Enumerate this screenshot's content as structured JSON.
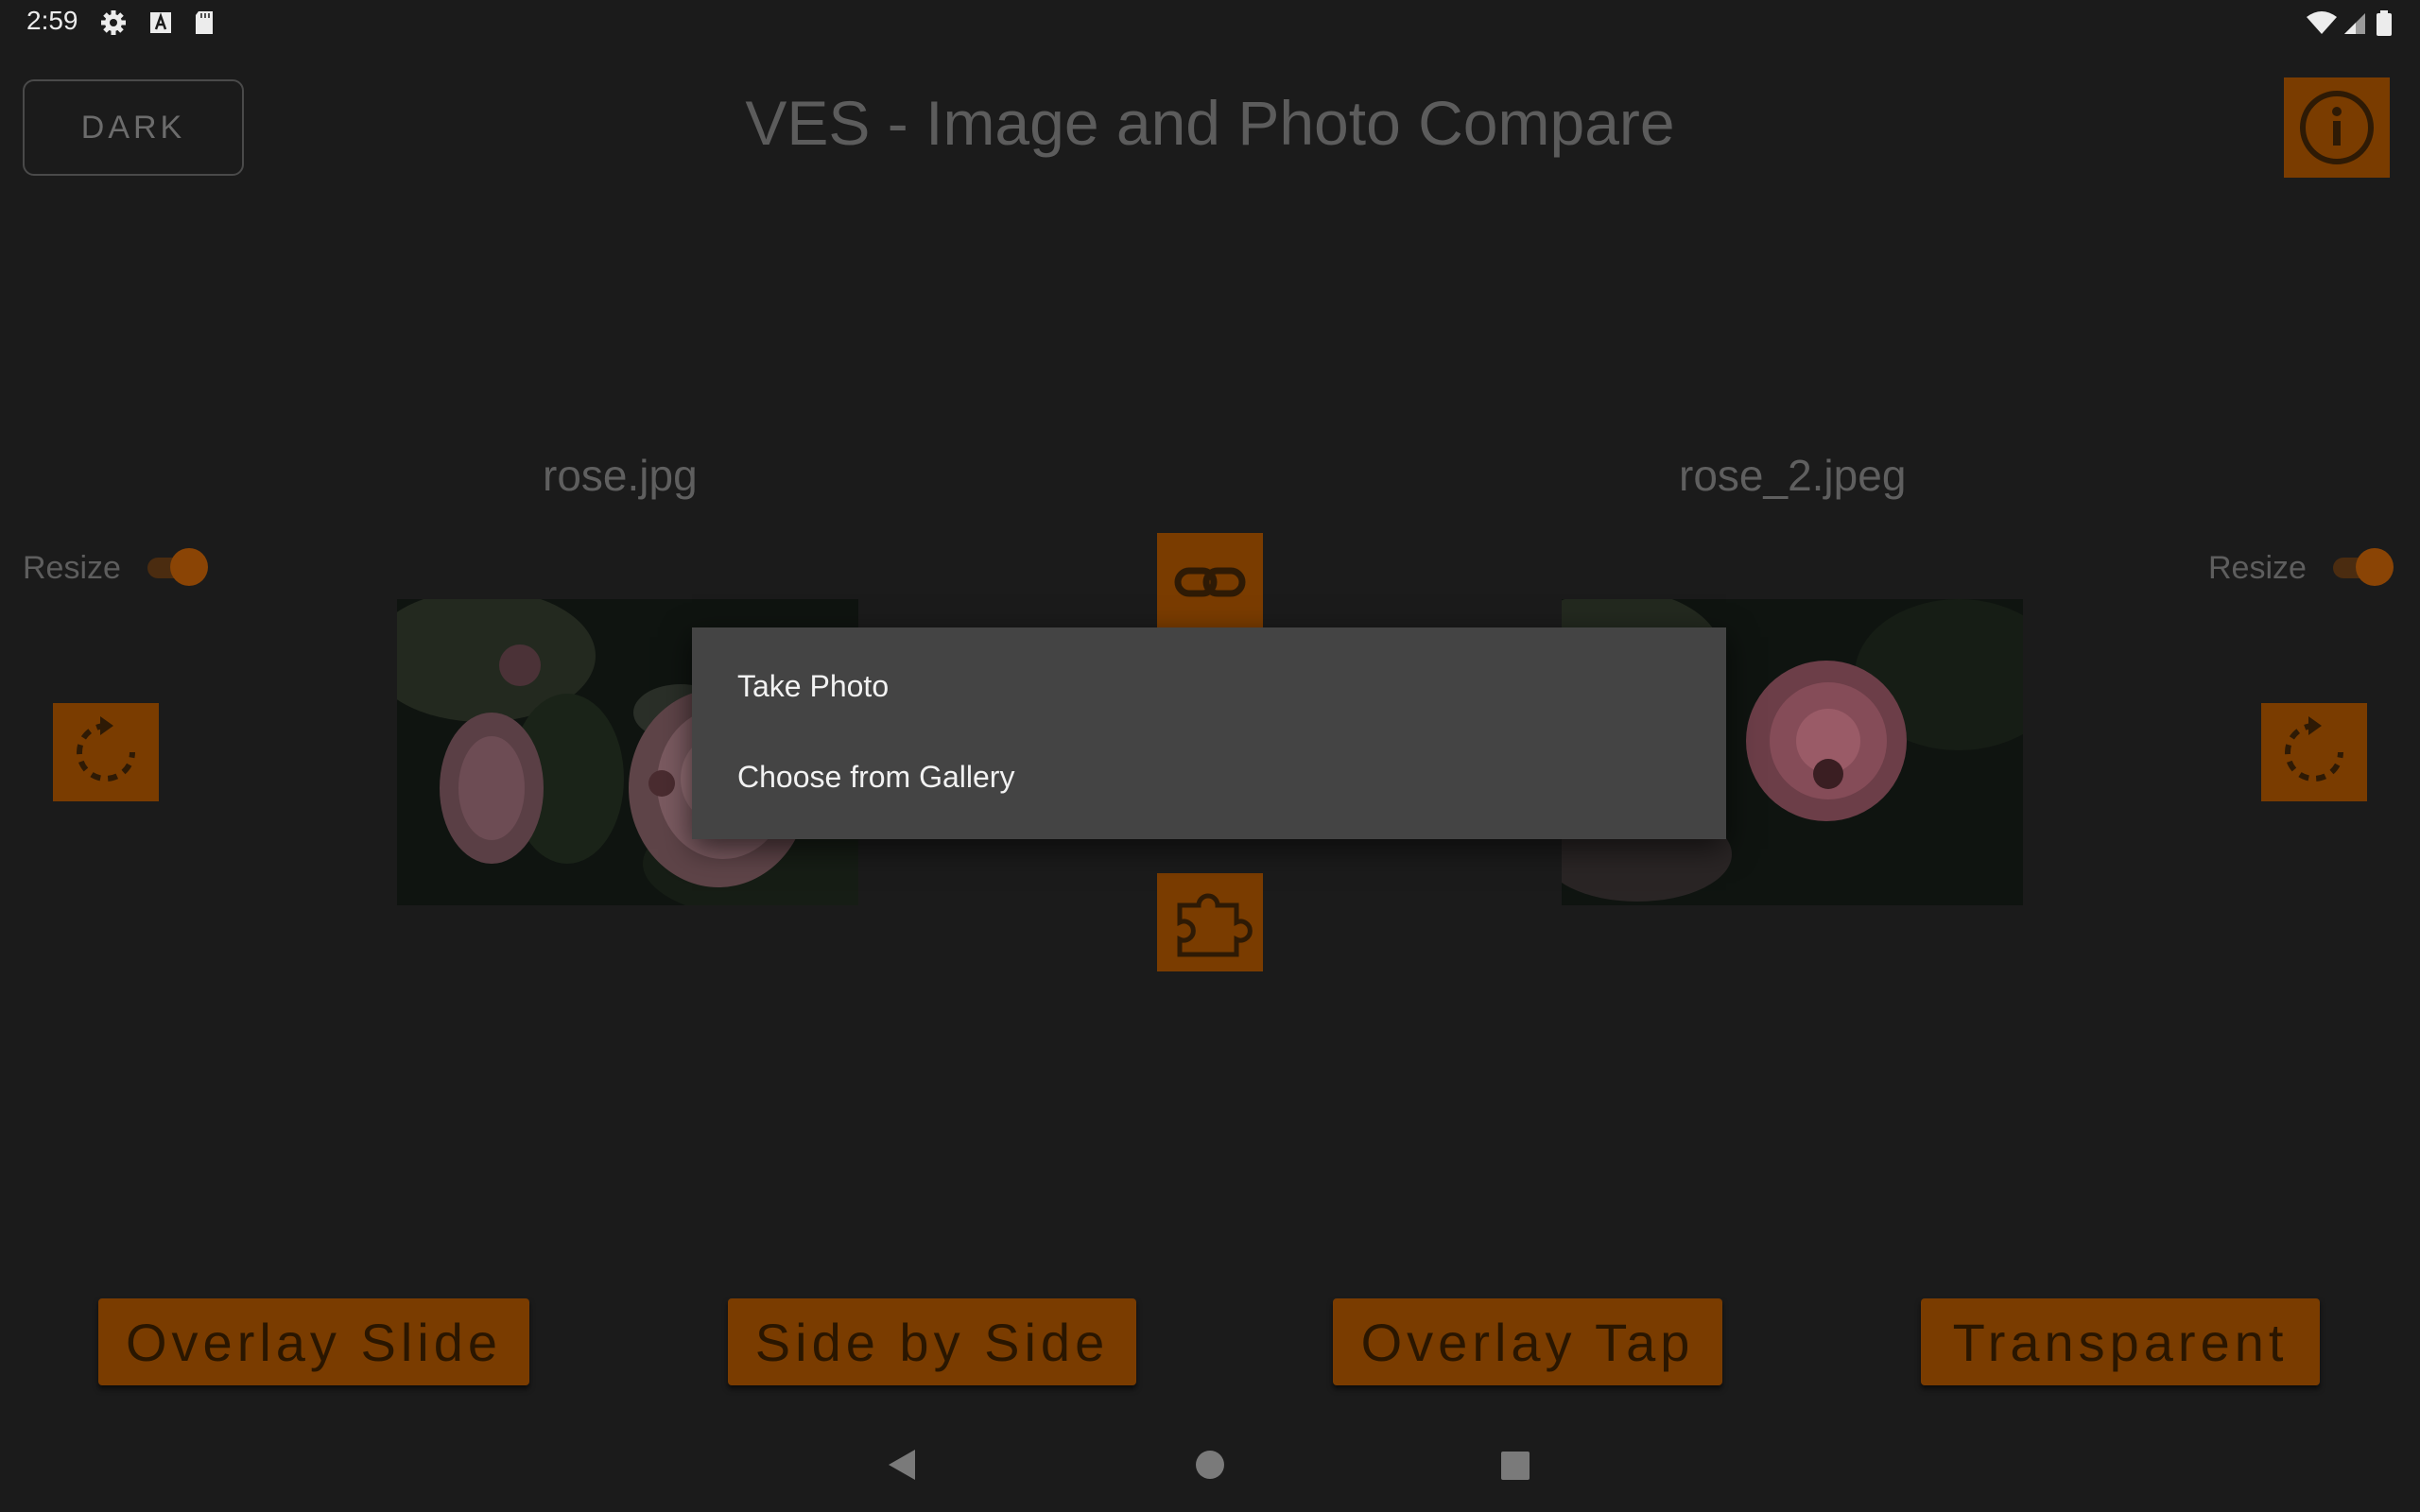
{
  "status_bar": {
    "time": "2:59",
    "icons": [
      "settings-icon",
      "a-icon",
      "sd-card-icon",
      "wifi-icon",
      "signal-icon",
      "battery-icon"
    ]
  },
  "header": {
    "theme_button_label": "DARK",
    "title": "VES - Image and Photo Compare",
    "info_icon": "info-icon"
  },
  "left_panel": {
    "file_name": "rose.jpg",
    "resize_label": "Resize",
    "resize_on": true,
    "rotate_icon": "rotate-icon"
  },
  "right_panel": {
    "file_name": "rose_2.jpeg",
    "resize_label": "Resize",
    "resize_on": true,
    "rotate_icon": "rotate-icon"
  },
  "center_controls": {
    "link_icon": "link-icon",
    "puzzle_icon": "puzzle-icon"
  },
  "dialog": {
    "items": [
      "Take Photo",
      "Choose from Gallery"
    ]
  },
  "modes": [
    "Overlay Slide",
    "Side by Side",
    "Overlay Tap",
    "Transparent"
  ],
  "nav_bar": {
    "icons": [
      "back-icon",
      "home-icon",
      "recents-icon"
    ]
  },
  "colors": {
    "background": "#1b1b1b",
    "accent_dimmed": "#7a3c00",
    "dialog": "#444444"
  }
}
